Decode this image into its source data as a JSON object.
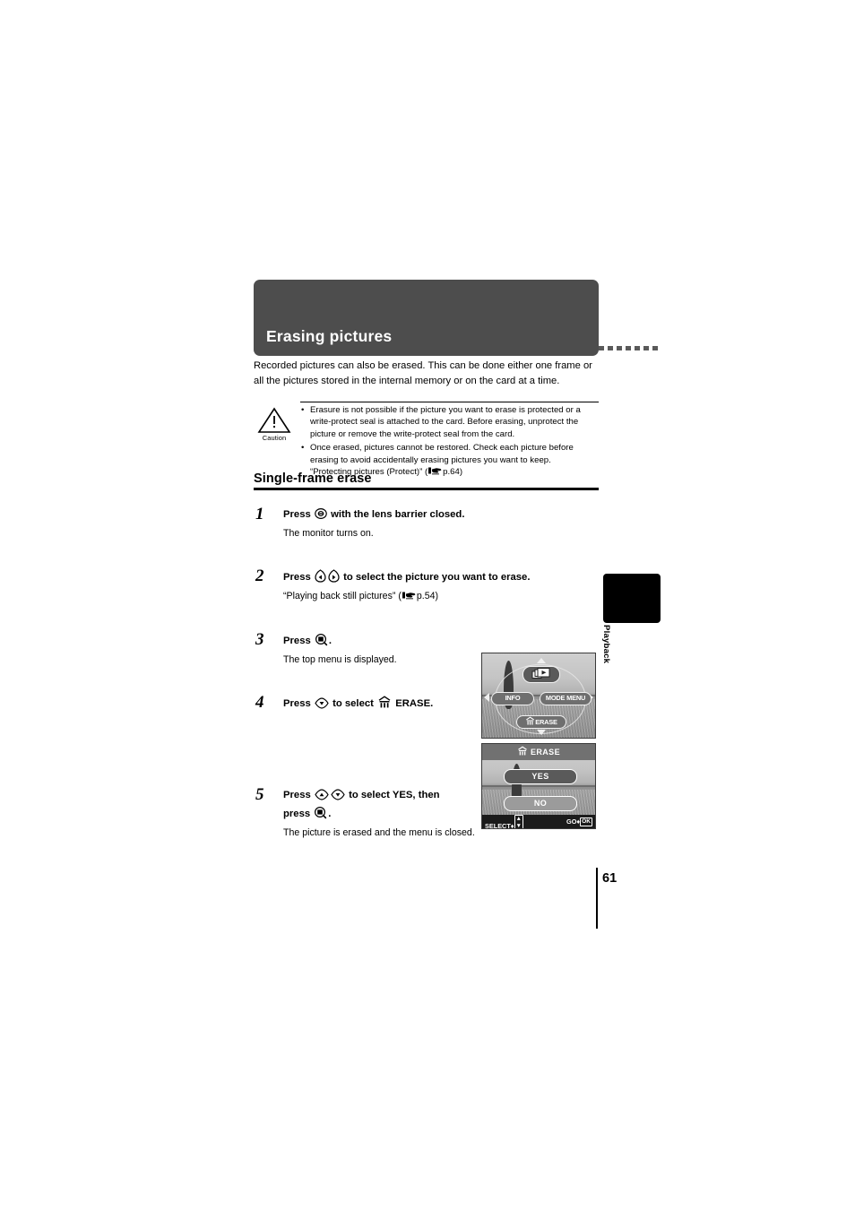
{
  "header": {
    "title": "Erasing pictures"
  },
  "intro": {
    "text": "Recorded pictures can also be erased. This can be done either one frame or all the pictures stored in the internal memory or on the card at a time."
  },
  "caution": {
    "label": "Caution",
    "bullet": "•",
    "items": [
      "Erasure is not possible if the picture you want to erase is protected or a write-protect seal is attached to the card. Before erasing, unprotect the picture or remove the write-protect seal from the card.",
      "Once erased, pictures cannot be restored. Check each picture before erasing to avoid accidentally erasing pictures you want to keep."
    ],
    "reference": {
      "prefix": "“Protecting pictures (Protect)” (",
      "page": "p.64",
      "suffix": ")"
    }
  },
  "subheading": {
    "text": "Single-frame erase"
  },
  "steps": [
    {
      "number": "1",
      "head_before": "Press",
      "icon": "monitor-button-icon",
      "head_after": "with the lens barrier closed.",
      "sub": "The monitor turns on."
    },
    {
      "number": "2",
      "head_before": "Press",
      "icon": "arrow-left-right-buttons-icon",
      "head_after": "to select the picture you want to erase.",
      "sub_prefix": "“Playing back still pictures” (",
      "sub_page": "p.54",
      "sub_suffix": ")"
    },
    {
      "number": "3",
      "head_before": "Press",
      "icon": "ok-menu-button-icon",
      "head_after": ".",
      "sub": "The top menu is displayed."
    },
    {
      "number": "4",
      "head_before": "Press",
      "icon": "arrow-down-button-icon",
      "head_mid": "to select",
      "icon2": "trash-erase-icon",
      "head_after": "ERASE.",
      "sub": ""
    },
    {
      "number": "5",
      "head_before": "Press",
      "icon": "arrow-up-button-icon",
      "icon2": "arrow-down-button-icon",
      "head_mid": "to select YES, then",
      "head_line2_before": "press",
      "icon3": "ok-menu-button-icon",
      "head_line2_after": ".",
      "sub": "The picture is erased and the menu is closed."
    }
  ],
  "lcd_top_menu": {
    "play_label": "",
    "info_label": "INFO",
    "mode_menu_label": "MODE MENU",
    "erase_label": "ERASE"
  },
  "lcd_erase_dialog": {
    "title": "ERASE",
    "yes_label": "YES",
    "no_label": "NO",
    "footer_left": "SELECT",
    "footer_left_sep": "♦",
    "footer_right": "GO",
    "footer_right_sep": "♦",
    "footer_right_key": "OK"
  },
  "side_tab": {
    "label": "Playback"
  },
  "page_number": "61",
  "colors": {
    "header_bg": "#4d4d4d",
    "header_text": "#ffffff",
    "body_text": "#000000",
    "tab_bg": "#000000",
    "lcd_bg": "#9a9a9a"
  }
}
